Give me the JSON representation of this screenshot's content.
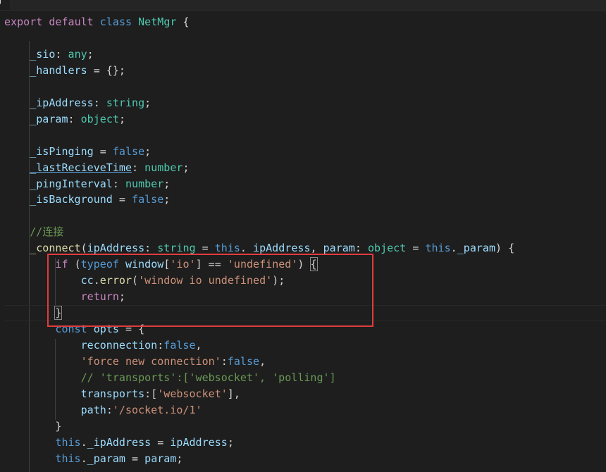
{
  "tab": {
    "label": "g"
  },
  "code_lines": [
    {
      "tokens": [
        {
          "t": "export",
          "c": "tok-ctl"
        },
        {
          "t": " "
        },
        {
          "t": "default",
          "c": "tok-ctl"
        },
        {
          "t": " "
        },
        {
          "t": "class",
          "c": "tok-kw"
        },
        {
          "t": " "
        },
        {
          "t": "NetMgr",
          "c": "tok-cls"
        },
        {
          "t": " {"
        }
      ]
    },
    {
      "tokens": []
    },
    {
      "tokens": [
        {
          "t": "    "
        },
        {
          "t": "_sio",
          "c": "tok-prop"
        },
        {
          "t": ": "
        },
        {
          "t": "any",
          "c": "tok-type"
        },
        {
          "t": ";"
        }
      ]
    },
    {
      "tokens": [
        {
          "t": "    "
        },
        {
          "t": "_handlers",
          "c": "tok-prop"
        },
        {
          "t": " = {};"
        }
      ]
    },
    {
      "tokens": []
    },
    {
      "tokens": [
        {
          "t": "    "
        },
        {
          "t": "_ipAddress",
          "c": "tok-prop"
        },
        {
          "t": ": "
        },
        {
          "t": "string",
          "c": "tok-type"
        },
        {
          "t": ";"
        }
      ]
    },
    {
      "tokens": [
        {
          "t": "    "
        },
        {
          "t": "_param",
          "c": "tok-prop"
        },
        {
          "t": ": "
        },
        {
          "t": "object",
          "c": "tok-type"
        },
        {
          "t": ";"
        }
      ]
    },
    {
      "tokens": []
    },
    {
      "tokens": [
        {
          "t": "    "
        },
        {
          "t": "_isPinging",
          "c": "tok-prop"
        },
        {
          "t": " = "
        },
        {
          "t": "false",
          "c": "tok-kw"
        },
        {
          "t": ";"
        }
      ]
    },
    {
      "tokens": [
        {
          "t": "    "
        },
        {
          "t": "_lastRecieveTime",
          "c": "tok-link"
        },
        {
          "t": ": "
        },
        {
          "t": "number",
          "c": "tok-type"
        },
        {
          "t": ";"
        }
      ]
    },
    {
      "tokens": [
        {
          "t": "    "
        },
        {
          "t": "_pingInterval",
          "c": "tok-prop"
        },
        {
          "t": ": "
        },
        {
          "t": "number",
          "c": "tok-type"
        },
        {
          "t": ";"
        }
      ]
    },
    {
      "tokens": [
        {
          "t": "    "
        },
        {
          "t": "_isBackground",
          "c": "tok-prop"
        },
        {
          "t": " = "
        },
        {
          "t": "false",
          "c": "tok-kw"
        },
        {
          "t": ";"
        }
      ]
    },
    {
      "tokens": []
    },
    {
      "tokens": [
        {
          "t": "    "
        },
        {
          "t": "//连接",
          "c": "tok-com"
        }
      ]
    },
    {
      "tokens": [
        {
          "t": "    "
        },
        {
          "t": "_connect",
          "c": "tok-fn"
        },
        {
          "t": "("
        },
        {
          "t": "ipAddress",
          "c": "tok-prop"
        },
        {
          "t": ": "
        },
        {
          "t": "string",
          "c": "tok-type"
        },
        {
          "t": " = "
        },
        {
          "t": "this",
          "c": "tok-kw"
        },
        {
          "t": "."
        },
        {
          "t": "_ipAddress",
          "c": "tok-prop"
        },
        {
          "t": ", "
        },
        {
          "t": "param",
          "c": "tok-prop"
        },
        {
          "t": ": "
        },
        {
          "t": "object",
          "c": "tok-type"
        },
        {
          "t": " = "
        },
        {
          "t": "this",
          "c": "tok-kw"
        },
        {
          "t": "."
        },
        {
          "t": "_param",
          "c": "tok-prop"
        },
        {
          "t": ") {"
        }
      ]
    },
    {
      "tokens": [
        {
          "t": "        "
        },
        {
          "t": "if",
          "c": "tok-ctl"
        },
        {
          "t": " ("
        },
        {
          "t": "typeof",
          "c": "tok-kw"
        },
        {
          "t": " "
        },
        {
          "t": "window",
          "c": "tok-prop"
        },
        {
          "t": "["
        },
        {
          "t": "'io'",
          "c": "tok-str"
        },
        {
          "t": "] == "
        },
        {
          "t": "'undefined'",
          "c": "tok-str"
        },
        {
          "t": ") "
        },
        {
          "t": "{",
          "c": "bracket-box"
        }
      ]
    },
    {
      "tokens": [
        {
          "t": "            "
        },
        {
          "t": "cc",
          "c": "tok-prop"
        },
        {
          "t": "."
        },
        {
          "t": "error",
          "c": "tok-fn"
        },
        {
          "t": "("
        },
        {
          "t": "'window io undefined'",
          "c": "tok-str"
        },
        {
          "t": ");"
        }
      ]
    },
    {
      "tokens": [
        {
          "t": "            "
        },
        {
          "t": "return",
          "c": "tok-ctl"
        },
        {
          "t": ";"
        }
      ]
    },
    {
      "tokens": [
        {
          "t": "        "
        },
        {
          "t": "}",
          "c": "bracket-box"
        }
      ]
    },
    {
      "tokens": [
        {
          "t": "        "
        },
        {
          "t": "const",
          "c": "tok-kw"
        },
        {
          "t": " "
        },
        {
          "t": "opts",
          "c": "tok-prop"
        },
        {
          "t": " = {"
        }
      ]
    },
    {
      "tokens": [
        {
          "t": "            "
        },
        {
          "t": "reconnection",
          "c": "tok-prop"
        },
        {
          "t": ":"
        },
        {
          "t": "false",
          "c": "tok-kw"
        },
        {
          "t": ","
        }
      ]
    },
    {
      "tokens": [
        {
          "t": "            "
        },
        {
          "t": "'force new connection'",
          "c": "tok-str"
        },
        {
          "t": ":"
        },
        {
          "t": "false",
          "c": "tok-kw"
        },
        {
          "t": ","
        }
      ]
    },
    {
      "tokens": [
        {
          "t": "            "
        },
        {
          "t": "// 'transports':['websocket', 'polling']",
          "c": "tok-com"
        }
      ]
    },
    {
      "tokens": [
        {
          "t": "            "
        },
        {
          "t": "transports",
          "c": "tok-prop"
        },
        {
          "t": ":["
        },
        {
          "t": "'websocket'",
          "c": "tok-str"
        },
        {
          "t": "],"
        }
      ]
    },
    {
      "tokens": [
        {
          "t": "            "
        },
        {
          "t": "path",
          "c": "tok-prop"
        },
        {
          "t": ":"
        },
        {
          "t": "'/socket.io/1'",
          "c": "tok-str"
        }
      ]
    },
    {
      "tokens": [
        {
          "t": "        }"
        }
      ]
    },
    {
      "tokens": [
        {
          "t": "        "
        },
        {
          "t": "this",
          "c": "tok-kw"
        },
        {
          "t": "."
        },
        {
          "t": "_ipAddress",
          "c": "tok-prop"
        },
        {
          "t": " = "
        },
        {
          "t": "ipAddress",
          "c": "tok-prop"
        },
        {
          "t": ";"
        }
      ]
    },
    {
      "tokens": [
        {
          "t": "        "
        },
        {
          "t": "this",
          "c": "tok-kw"
        },
        {
          "t": "."
        },
        {
          "t": "_param",
          "c": "tok-prop"
        },
        {
          "t": " = "
        },
        {
          "t": "param",
          "c": "tok-prop"
        },
        {
          "t": ";"
        }
      ]
    }
  ]
}
